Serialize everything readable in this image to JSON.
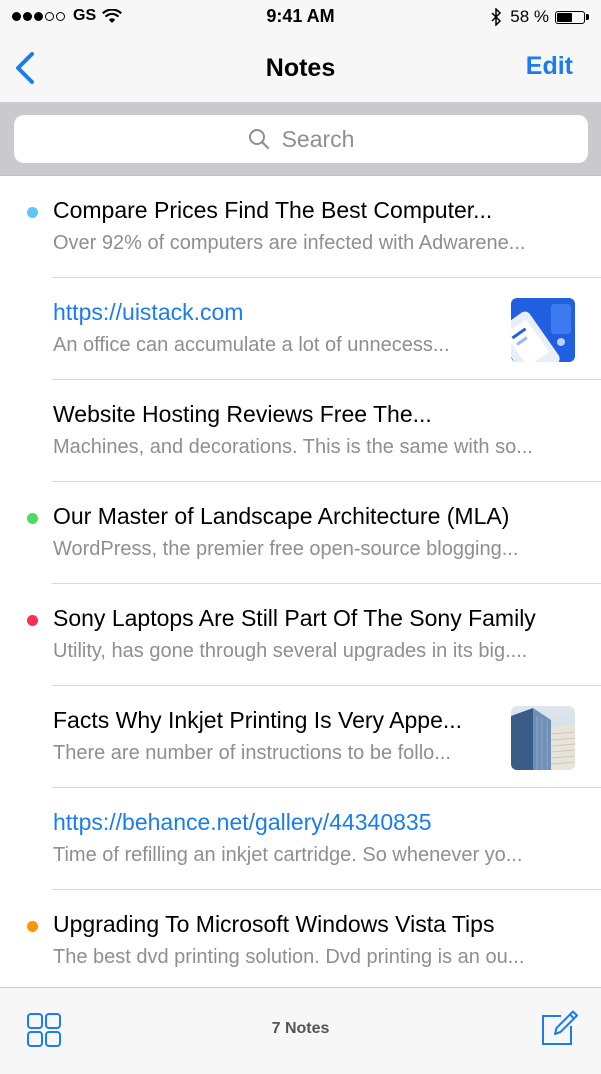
{
  "status_bar": {
    "carrier": "GS",
    "time": "9:41 AM",
    "battery_percent": "58 %",
    "battery_level": 0.58,
    "icons": [
      "signal-dots-icon",
      "wifi-icon",
      "bluetooth-icon",
      "battery-icon"
    ]
  },
  "nav": {
    "back_icon": "chevron-left-icon",
    "title": "Notes",
    "edit_label": "Edit"
  },
  "search": {
    "placeholder": "Search",
    "icon": "search-icon"
  },
  "notes": [
    {
      "title": "Compare Prices Find The Best Computer...",
      "preview": "Over 92% of computers are infected with Adwarene...",
      "dot_color": "#5ac8fa",
      "is_link": false,
      "thumbnail": null
    },
    {
      "title": "https://uistack.com",
      "preview": "An office can accumulate a lot of unnecess...",
      "dot_color": null,
      "is_link": true,
      "thumbnail": "app-screenshot-thumbnail"
    },
    {
      "title": "Website Hosting Reviews Free The...",
      "preview": "Machines, and decorations. This is the same with so...",
      "dot_color": null,
      "is_link": false,
      "thumbnail": null
    },
    {
      "title": "Our Master of Landscape Architecture (MLA)",
      "preview": "WordPress, the premier free open-source blogging...",
      "dot_color": "#4cd964",
      "is_link": false,
      "thumbnail": null
    },
    {
      "title": "Sony Laptops Are Still Part Of The Sony Family",
      "preview": "Utility, has gone through several upgrades in its big....",
      "dot_color": "#ff2d55",
      "is_link": false,
      "thumbnail": null
    },
    {
      "title": "Facts Why Inkjet Printing Is Very Appe...",
      "preview": "There are number of instructions to be follo...",
      "dot_color": null,
      "is_link": false,
      "thumbnail": "building-photo-thumbnail"
    },
    {
      "title": "https://behance.net/gallery/44340835",
      "preview": "Time of refilling an inkjet cartridge. So whenever yo...",
      "dot_color": null,
      "is_link": true,
      "thumbnail": null
    },
    {
      "title": "Upgrading To Microsoft Windows Vista Tips",
      "preview": "The best dvd printing solution. Dvd printing is an ou...",
      "dot_color": "#ff9500",
      "is_link": false,
      "thumbnail": null
    }
  ],
  "toolbar": {
    "grid_icon": "grid-view-icon",
    "count_label": "7 Notes",
    "compose_icon": "compose-icon"
  },
  "colors": {
    "accent": "#1a7cf0",
    "secondary_text": "#8e8e93",
    "bar_background": "#f7f7f7",
    "search_background": "#c9c9ce"
  }
}
